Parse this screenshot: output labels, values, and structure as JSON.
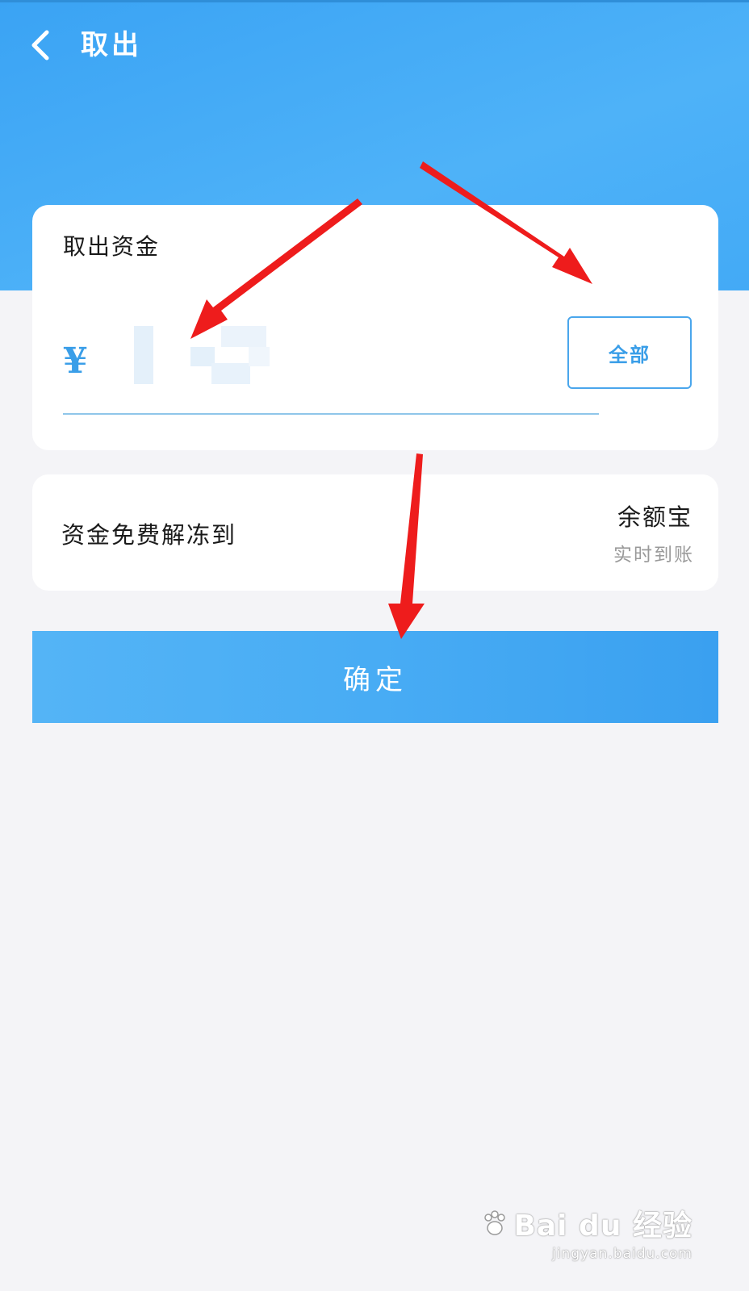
{
  "header": {
    "title": "取出",
    "back_icon": "chevron-left-icon"
  },
  "amount_card": {
    "label": "取出资金",
    "currency_symbol": "¥",
    "amount_value": "",
    "all_button_label": "全部",
    "accent_color": "#3a9ee8"
  },
  "destination_card": {
    "label": "资金免费解冻到",
    "destination_name": "余额宝",
    "destination_note": "实时到账"
  },
  "confirm_button": {
    "label": "确定"
  },
  "colors": {
    "header_blue": "#43aaf6",
    "background": "#f4f4f7",
    "annotation_red": "#ee1c1c"
  },
  "watermark": {
    "logo": "Bai du 经验",
    "url": "jingyan.baidu.com"
  }
}
